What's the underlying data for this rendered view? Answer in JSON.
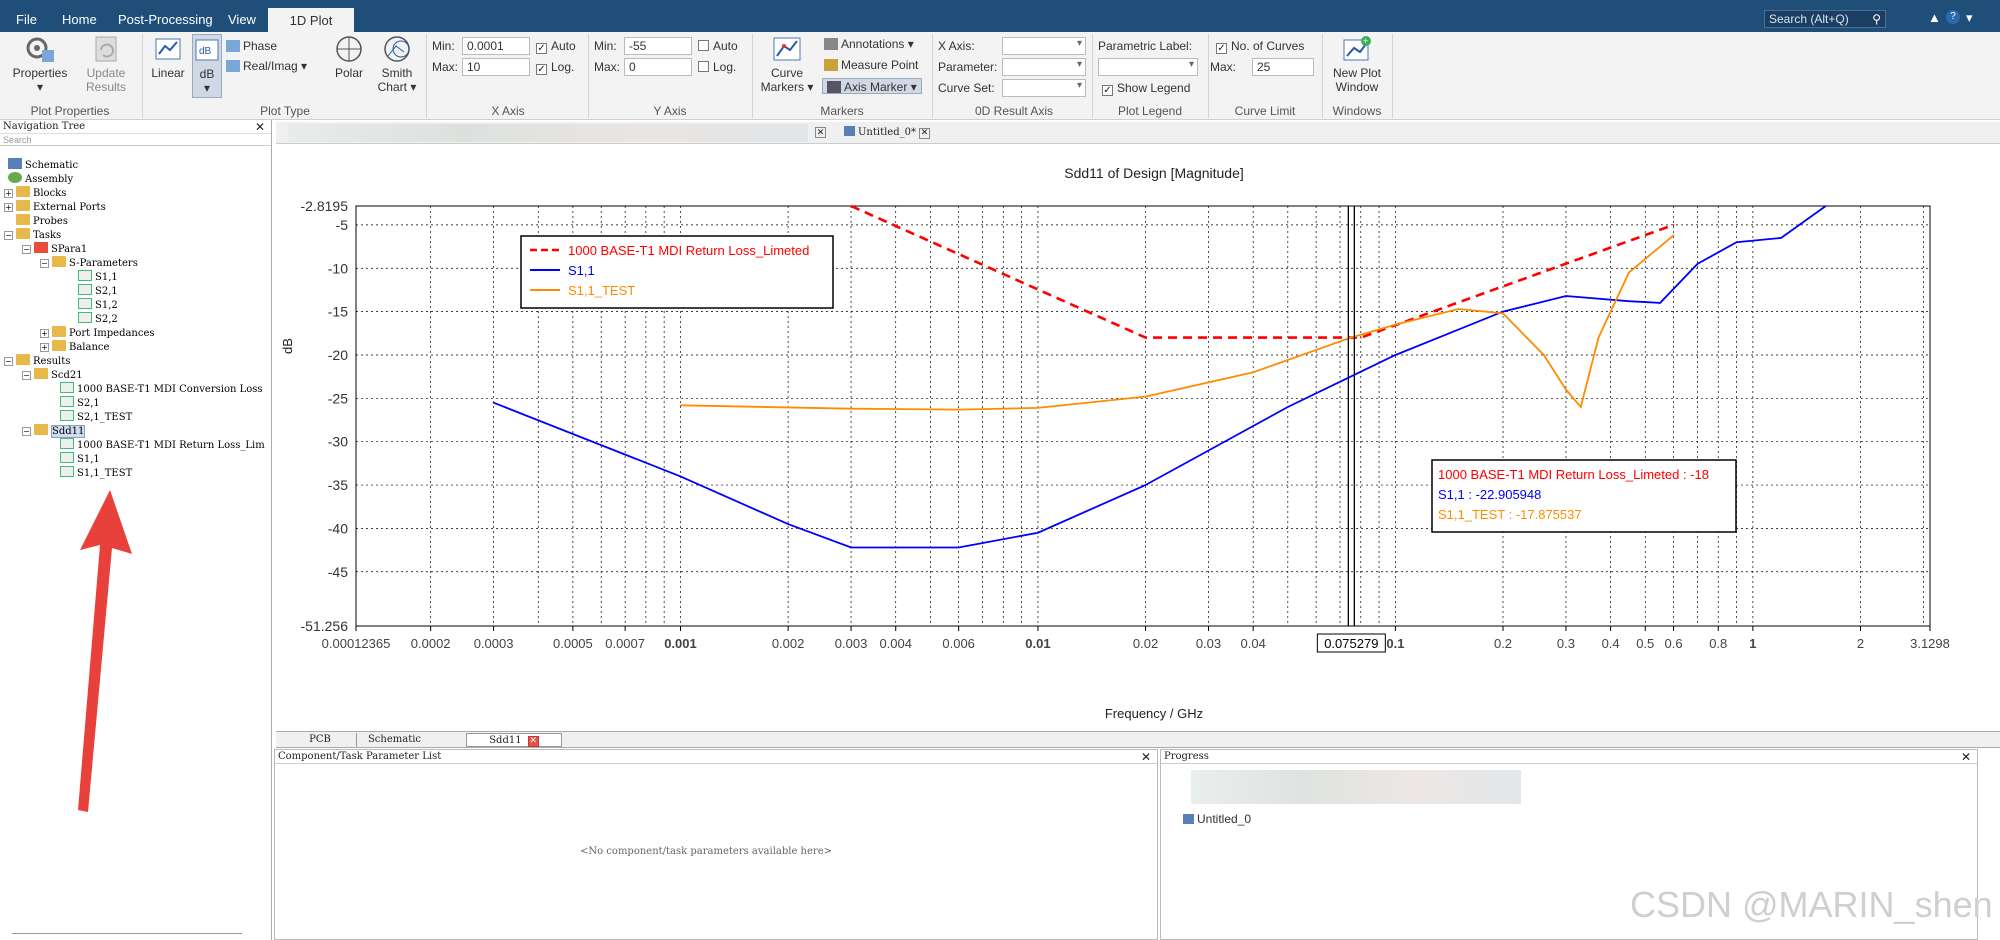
{
  "menu": {
    "tabs": [
      "File",
      "Home",
      "Post-Processing",
      "View",
      "1D Plot"
    ],
    "active_tab": "1D Plot"
  },
  "search": {
    "placeholder": "Search (Alt+Q)"
  },
  "ribbon": {
    "properties": "Properties",
    "update_results": "Update Results",
    "plot_properties_group": "Plot Properties",
    "linear": "Linear",
    "db": "dB",
    "phase": "Phase",
    "real_imag": "Real/Imag",
    "polar": "Polar",
    "smith_chart": "Smith Chart",
    "plot_type_group": "Plot Type",
    "x_axis_group": "X Axis",
    "x_min_label": "Min:",
    "x_min": "0.0001",
    "x_max_label": "Max:",
    "x_max": "10",
    "x_auto": "Auto",
    "x_auto_checked": true,
    "x_log": "Log.",
    "x_log_checked": true,
    "y_axis_group": "Y Axis",
    "y_min_label": "Min:",
    "y_min": "-55",
    "y_max_label": "Max:",
    "y_max": "0",
    "y_auto": "Auto",
    "y_auto_checked": false,
    "y_log": "Log.",
    "y_log_checked": false,
    "curve_markers": "Curve Markers",
    "annotations": "Annotations",
    "measure_point": "Measure Point",
    "axis_marker": "Axis Marker",
    "markers_group": "Markers",
    "x_axis_label": "X Axis:",
    "parameter_label": "Parameter:",
    "curve_set_label": "Curve Set:",
    "result_axis_group": "0D Result Axis",
    "parametric_label": "Parametric Label:",
    "show_legend": "Show Legend",
    "show_legend_checked": true,
    "plot_legend_group": "Plot Legend",
    "no_of_curves": "No. of Curves",
    "no_of_curves_checked": true,
    "max_label": "Max:",
    "max_curves": "25",
    "curve_limit_group": "Curve Limit",
    "new_plot_window": "New Plot Window",
    "windows_group": "Windows"
  },
  "nav": {
    "title": "Navigation Tree",
    "search_placeholder": "Search",
    "items": [
      {
        "label": "Schematic",
        "icon": "schematic-icon"
      },
      {
        "label": "Assembly",
        "icon": "assembly-icon"
      },
      {
        "label": "Blocks",
        "icon": "folder-icon"
      },
      {
        "label": "External Ports",
        "icon": "folder-icon"
      },
      {
        "label": "Probes",
        "icon": "folder-icon"
      },
      {
        "label": "Tasks",
        "icon": "folder-icon"
      },
      {
        "label": "SPara1",
        "icon": "task-icon"
      },
      {
        "label": "S-Parameters",
        "icon": "folder-icon"
      },
      {
        "label": "S1,1",
        "icon": "curve-icon"
      },
      {
        "label": "S2,1",
        "icon": "curve-icon"
      },
      {
        "label": "S1,2",
        "icon": "curve-icon"
      },
      {
        "label": "S2,2",
        "icon": "curve-icon"
      },
      {
        "label": "Port Impedances",
        "icon": "folder-icon"
      },
      {
        "label": "Balance",
        "icon": "folder-icon"
      },
      {
        "label": "Results",
        "icon": "folder-icon"
      },
      {
        "label": "Scd21",
        "icon": "folder-icon"
      },
      {
        "label": "1000 BASE-T1 MDI Conversion Loss",
        "icon": "curve-icon"
      },
      {
        "label": "S2,1",
        "icon": "curve-icon"
      },
      {
        "label": "S2,1_TEST",
        "icon": "curve-icon"
      },
      {
        "label": "Sdd11",
        "icon": "folder-icon"
      },
      {
        "label": "1000 BASE-T1 MDI Return Loss_Lim",
        "icon": "curve-icon"
      },
      {
        "label": "S1,1",
        "icon": "curve-icon"
      },
      {
        "label": "S1,1_TEST",
        "icon": "curve-icon"
      }
    ]
  },
  "doc_tabs": [
    {
      "label": "Untitled_0*"
    }
  ],
  "plot": {
    "x_cursor_readout": "0.075279"
  },
  "chart_data": {
    "type": "line",
    "title": "Sdd11 of Design [Magnitude]",
    "xlabel": "Frequency / GHz",
    "ylabel": "dB",
    "xscale": "log",
    "xlim": [
      0.00012365,
      3.1298
    ],
    "ylim": [
      -51.256,
      -2.8195
    ],
    "x_ticks": [
      "0.00012365",
      "0.0002",
      "0.0003",
      "0.0005",
      "0.0007",
      "0.001",
      "0.002",
      "0.003",
      "0.004",
      "0.006",
      "0.01",
      "0.02",
      "0.03",
      "0.04",
      "0.1",
      "0.2",
      "0.3",
      "0.4",
      "0.5",
      "0.6",
      "0.8",
      "1",
      "2",
      "3.1298"
    ],
    "y_ticks": [
      "-2.8195",
      "-5",
      "-10",
      "-15",
      "-20",
      "-25",
      "-30",
      "-35",
      "-40",
      "-45",
      "-51.256"
    ],
    "grid": true,
    "legend_position": "top-left",
    "cursor_x": 0.075279,
    "series": [
      {
        "name": "1000 BASE-T1 MDI Return Loss_Limeted",
        "color": "#ff0000",
        "dash": true,
        "x": [
          0.003,
          0.02,
          0.08,
          0.6
        ],
        "y": [
          -2.8195,
          -18,
          -18,
          -5
        ]
      },
      {
        "name": "S1,1",
        "color": "#0000ff",
        "dash": false,
        "x": [
          0.0003,
          0.001,
          0.002,
          0.003,
          0.006,
          0.01,
          0.02,
          0.05,
          0.1,
          0.2,
          0.3,
          0.45,
          0.55,
          0.7,
          0.9,
          1.2,
          1.6
        ],
        "y": [
          -25.5,
          -34,
          -39.5,
          -42.2,
          -42.2,
          -40.5,
          -35,
          -26,
          -20,
          -15,
          -13.2,
          -13.8,
          -14,
          -9.5,
          -7,
          -6.5,
          -2.8195
        ]
      },
      {
        "name": "S1,1_TEST",
        "color": "#ff8c00",
        "dash": false,
        "x": [
          0.001,
          0.003,
          0.006,
          0.01,
          0.02,
          0.04,
          0.075,
          0.1,
          0.15,
          0.2,
          0.26,
          0.3,
          0.33,
          0.37,
          0.45,
          0.6
        ],
        "y": [
          -25.8,
          -26.2,
          -26.3,
          -26.1,
          -24.8,
          -22,
          -18,
          -16.5,
          -14.7,
          -15.2,
          -20,
          -24,
          -26,
          -18,
          -10.5,
          -6.2
        ]
      }
    ],
    "marker_readout": [
      {
        "text": "1000 BASE-T1 MDI Return Loss_Limeted : -18",
        "color": "#ff0000"
      },
      {
        "text": "S1,1 : -22.905948",
        "color": "#0000ff"
      },
      {
        "text": "S1,1_TEST : -17.875537",
        "color": "#ff8c00"
      }
    ]
  },
  "bottom_tabs": [
    {
      "label": "PCB"
    },
    {
      "label": "Schematic"
    },
    {
      "label": "Sdd11"
    }
  ],
  "panels": {
    "params_title": "Component/Task Parameter List",
    "params_empty": "<No component/task parameters available here>",
    "progress_title": "Progress",
    "progress_item": "Untitled_0"
  },
  "watermark": "CSDN @MARIN_shen",
  "colors": {
    "titlebar": "#1f4e79",
    "ribbon": "#f3f3f3",
    "annotation_arrow": "#e8403a"
  }
}
